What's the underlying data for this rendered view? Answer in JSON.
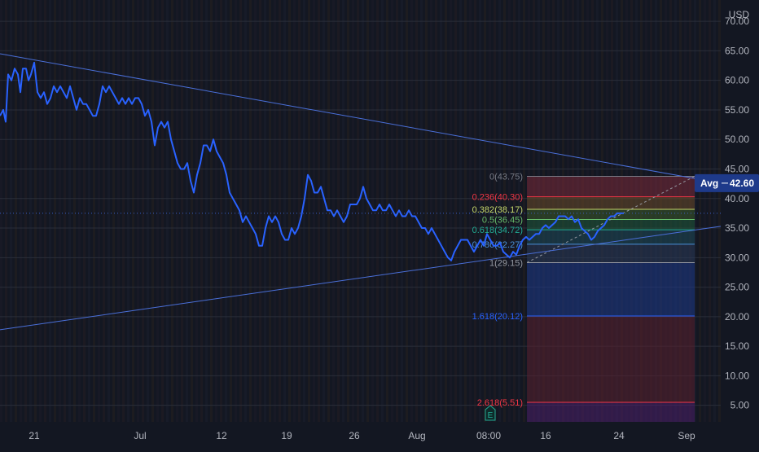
{
  "chart_data": {
    "type": "line",
    "currency": "USD",
    "y_ticks": [
      5,
      10,
      15,
      20,
      25,
      30,
      35,
      40,
      45,
      50,
      55,
      60,
      65,
      70
    ],
    "y_tick_labels": [
      "5.00",
      "10.00",
      "15.00",
      "20.00",
      "25.00",
      "30.00",
      "35.00",
      "40.00",
      "45.00",
      "50.00",
      "55.00",
      "60.00",
      "65.00",
      "70.00"
    ],
    "ylim": [
      2.2,
      73.6
    ],
    "x_tick_labels": [
      "21",
      "Jul",
      "12",
      "19",
      "26",
      "Aug",
      "08:00",
      "16",
      "24",
      "Sep"
    ],
    "series": [
      {
        "color": "#2962ff",
        "points": [
          [
            0,
            54
          ],
          [
            4,
            55
          ],
          [
            7,
            53
          ],
          [
            10,
            61
          ],
          [
            14,
            60
          ],
          [
            18,
            62
          ],
          [
            22,
            61
          ],
          [
            25,
            58
          ],
          [
            28,
            62
          ],
          [
            32,
            62
          ],
          [
            35,
            60
          ],
          [
            38,
            61
          ],
          [
            42,
            63
          ],
          [
            46,
            58
          ],
          [
            50,
            57
          ],
          [
            54,
            58
          ],
          [
            58,
            56
          ],
          [
            62,
            57
          ],
          [
            66,
            59
          ],
          [
            70,
            58
          ],
          [
            74,
            59
          ],
          [
            78,
            58
          ],
          [
            82,
            57
          ],
          [
            86,
            59
          ],
          [
            90,
            57
          ],
          [
            94,
            55
          ],
          [
            98,
            57
          ],
          [
            102,
            56
          ],
          [
            106,
            56
          ],
          [
            110,
            55
          ],
          [
            114,
            54
          ],
          [
            118,
            54
          ],
          [
            122,
            56
          ],
          [
            126,
            59
          ],
          [
            130,
            58
          ],
          [
            134,
            59
          ],
          [
            138,
            58
          ],
          [
            142,
            57
          ],
          [
            146,
            56
          ],
          [
            150,
            57
          ],
          [
            154,
            56
          ],
          [
            158,
            57
          ],
          [
            162,
            56
          ],
          [
            166,
            57
          ],
          [
            170,
            57
          ],
          [
            174,
            56
          ],
          [
            178,
            54
          ],
          [
            182,
            55
          ],
          [
            186,
            53
          ],
          [
            190,
            49
          ],
          [
            194,
            52
          ],
          [
            198,
            53
          ],
          [
            202,
            52
          ],
          [
            206,
            53
          ],
          [
            210,
            50
          ],
          [
            214,
            48
          ],
          [
            218,
            46
          ],
          [
            222,
            45
          ],
          [
            226,
            45
          ],
          [
            230,
            46
          ],
          [
            234,
            43
          ],
          [
            238,
            41
          ],
          [
            242,
            44
          ],
          [
            246,
            46
          ],
          [
            250,
            49
          ],
          [
            254,
            49
          ],
          [
            258,
            48
          ],
          [
            262,
            50
          ],
          [
            266,
            48
          ],
          [
            270,
            47
          ],
          [
            274,
            46
          ],
          [
            278,
            44
          ],
          [
            282,
            41
          ],
          [
            286,
            40
          ],
          [
            290,
            39
          ],
          [
            294,
            38
          ],
          [
            298,
            36
          ],
          [
            302,
            37
          ],
          [
            306,
            36
          ],
          [
            310,
            35
          ],
          [
            314,
            34
          ],
          [
            318,
            32
          ],
          [
            322,
            32
          ],
          [
            326,
            35
          ],
          [
            330,
            37
          ],
          [
            334,
            36
          ],
          [
            338,
            37
          ],
          [
            342,
            36
          ],
          [
            346,
            34
          ],
          [
            350,
            33
          ],
          [
            354,
            33
          ],
          [
            358,
            35
          ],
          [
            362,
            34
          ],
          [
            366,
            35
          ],
          [
            370,
            37
          ],
          [
            374,
            40
          ],
          [
            378,
            44
          ],
          [
            382,
            43
          ],
          [
            386,
            41
          ],
          [
            390,
            41
          ],
          [
            394,
            42
          ],
          [
            398,
            40
          ],
          [
            402,
            38
          ],
          [
            406,
            38
          ],
          [
            410,
            37
          ],
          [
            414,
            38
          ],
          [
            418,
            37
          ],
          [
            422,
            36
          ],
          [
            426,
            37
          ],
          [
            430,
            39
          ],
          [
            434,
            39
          ],
          [
            438,
            39
          ],
          [
            442,
            40
          ],
          [
            446,
            42
          ],
          [
            450,
            40
          ],
          [
            454,
            39
          ],
          [
            458,
            38
          ],
          [
            462,
            38
          ],
          [
            466,
            39
          ],
          [
            470,
            38
          ],
          [
            474,
            38
          ],
          [
            478,
            39
          ],
          [
            482,
            38
          ],
          [
            486,
            37
          ],
          [
            490,
            38
          ],
          [
            494,
            37
          ],
          [
            498,
            37
          ],
          [
            502,
            38
          ],
          [
            506,
            37
          ],
          [
            510,
            37
          ],
          [
            514,
            36
          ],
          [
            518,
            35
          ],
          [
            522,
            35
          ],
          [
            526,
            34
          ],
          [
            530,
            35
          ],
          [
            534,
            34
          ],
          [
            538,
            33
          ],
          [
            542,
            32
          ],
          [
            546,
            31
          ],
          [
            550,
            30
          ],
          [
            554,
            29.5
          ],
          [
            558,
            31
          ],
          [
            562,
            32
          ],
          [
            566,
            33
          ],
          [
            570,
            33
          ],
          [
            574,
            33
          ],
          [
            578,
            32
          ],
          [
            582,
            31
          ],
          [
            586,
            32
          ],
          [
            590,
            33
          ],
          [
            594,
            32
          ],
          [
            598,
            34
          ],
          [
            602,
            33
          ],
          [
            606,
            32
          ],
          [
            610,
            32
          ],
          [
            614,
            32.5
          ],
          [
            618,
            31
          ],
          [
            622,
            30.5
          ],
          [
            626,
            30
          ],
          [
            630,
            31
          ],
          [
            634,
            30.5
          ],
          [
            638,
            32
          ],
          [
            642,
            33
          ],
          [
            646,
            33.5
          ],
          [
            650,
            33
          ],
          [
            654,
            33.5
          ],
          [
            658,
            34
          ],
          [
            662,
            34
          ],
          [
            666,
            35
          ],
          [
            670,
            35.5
          ],
          [
            674,
            35
          ],
          [
            678,
            35.5
          ],
          [
            682,
            36
          ],
          [
            686,
            37
          ],
          [
            690,
            37
          ],
          [
            694,
            37
          ],
          [
            698,
            36.5
          ],
          [
            702,
            37
          ],
          [
            706,
            36
          ],
          [
            710,
            36.5
          ],
          [
            714,
            35
          ],
          [
            718,
            34.5
          ],
          [
            722,
            34
          ],
          [
            726,
            33
          ],
          [
            730,
            33.5
          ],
          [
            734,
            34.5
          ],
          [
            738,
            35
          ],
          [
            742,
            35.5
          ],
          [
            746,
            36.5
          ],
          [
            750,
            37
          ],
          [
            754,
            37
          ],
          [
            758,
            37.5
          ],
          [
            762,
            37.5
          ],
          [
            766,
            37.5
          ]
        ]
      }
    ],
    "last_price_line": 37.5,
    "fib": {
      "x_start": 647,
      "x_end": 853,
      "levels": [
        {
          "label": "0(43.75)",
          "value": 43.75,
          "color": "#787b86"
        },
        {
          "label": "0.236(40.30)",
          "value": 40.3,
          "color": "#f23645"
        },
        {
          "label": "0.382(38.17)",
          "value": 38.17,
          "color": "#c4d66b"
        },
        {
          "label": "0.5(36.45)",
          "value": 36.45,
          "color": "#66bb6a"
        },
        {
          "label": "0.618(34.72)",
          "value": 34.72,
          "color": "#22ab94"
        },
        {
          "label": "0.786(32.27)",
          "value": 32.27,
          "color": "#4a8fd8"
        },
        {
          "label": "1(29.15)",
          "value": 29.15,
          "color": "#9598a1"
        },
        {
          "label": "1.618(20.12)",
          "value": 20.12,
          "color": "#2962ff"
        },
        {
          "label": "2.618(5.51)",
          "value": 5.51,
          "color": "#f23645"
        }
      ]
    },
    "avg": {
      "label": "Avg",
      "value": "42.60"
    },
    "event_marker": "E"
  }
}
